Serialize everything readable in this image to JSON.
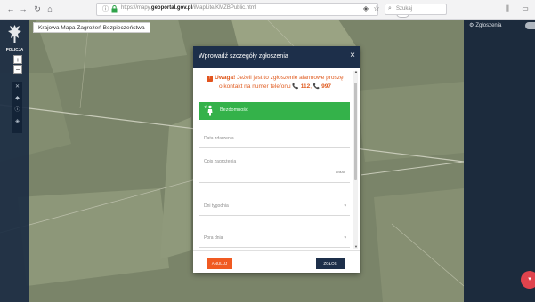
{
  "browser": {
    "url_prefix": "https://mapy.",
    "url_domain": "geoportal.gov.pl",
    "url_path": "/iMapLite/KMZBPublic.html",
    "zoom": "80%",
    "search_placeholder": "Szukaj",
    "icons": [
      "back-arrow",
      "forward-arrow",
      "reload",
      "home",
      "info",
      "lock",
      "page-actions",
      "pocket",
      "bookmark-star",
      "search",
      "library",
      "sidebar"
    ]
  },
  "app": {
    "title": "Krajowa Mapa Zagrożeń Bezpieczeństwa",
    "logo_text": "POLICJA",
    "zoom_in": "+",
    "zoom_out": "−"
  },
  "right_panel": {
    "header": "Zgłoszenia"
  },
  "dialog": {
    "title": "Wprowadź szczegóły zgłoszenia",
    "warning_strong": "Uwaga!",
    "warning_line1": " Jeżeli jest to zgłoszenie alarmowe proszę",
    "warning_line2": "o kontakt na numer telefonu",
    "phone1": "112",
    "phone2": "997",
    "category_button": "Bezdomność",
    "fields": {
      "date_label": "Data zdarzenia",
      "desc_label": "Opis zagrożenia",
      "desc_counter": "0/500",
      "weekday_label": "Dni tygodnia",
      "timeofday_label": "Pora dnia"
    },
    "cancel_label": "ANULUJ",
    "submit_label": "ZGŁOŚ"
  },
  "colors": {
    "map_base": "#7a8469",
    "header_navy": "#1d2f4a",
    "warning_orange": "#e05b1f",
    "category_green": "#34b24a",
    "cancel_orange": "#f05a22",
    "fab_red": "#e0434d"
  }
}
